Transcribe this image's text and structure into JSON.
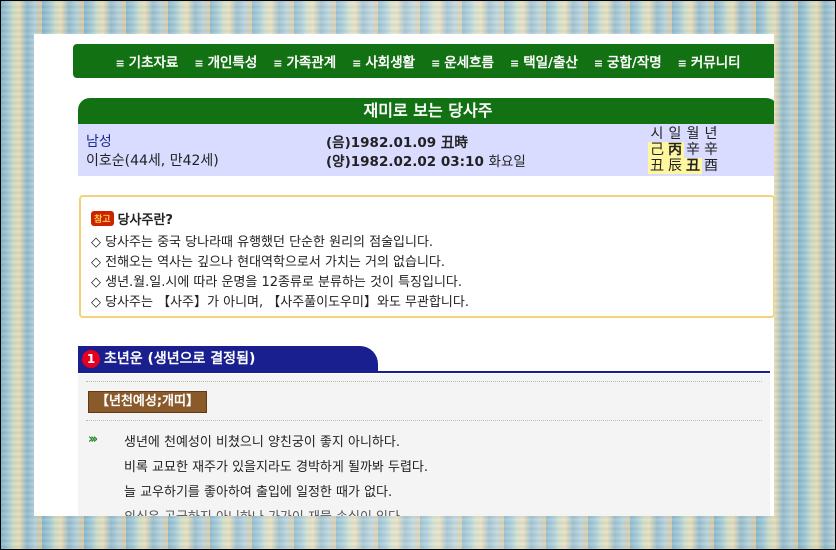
{
  "menu": [
    "기초자료",
    "개인특성",
    "가족관계",
    "사회생활",
    "운세흐름",
    "택일/출산",
    "궁합/작명",
    "커뮤니티"
  ],
  "menu_bullet": "≡",
  "title": "재미로 보는 당사주",
  "profile": {
    "gender": "남성",
    "name_age": "이호순(44세, 만42세)",
    "lunar": "(음)1982.01.09 丑時",
    "solar_date": "(양)1982.02.02 03:10",
    "solar_day": "화요일"
  },
  "pillars": {
    "headers": [
      "시",
      "일",
      "월",
      "년"
    ],
    "stems": [
      "己",
      "丙",
      "辛",
      "辛"
    ],
    "branches": [
      "丑",
      "辰",
      "丑",
      "酉"
    ]
  },
  "notice": {
    "badge": "참고",
    "title": "당사주란?",
    "lines": [
      "◇ 당사주는 중국 당나라때 유행했던 단순한 원리의 점술입니다.",
      "◇ 전해오는 역사는 깊으나 현대역학으로서 가치는 거의 없습니다.",
      "◇ 생년.월.일.시에 따라 운명을 12종류로 분류하는 것이 특징입니다.",
      "◇ 당사주는 【사주】가 아니며, 【사주풀이도우미】와도 무관합니다."
    ]
  },
  "section": {
    "number": "1",
    "title": "초년운 (생년으로 결정됨)",
    "subtitle": "【년천예성;개띠】",
    "paragraphs": [
      "생년에 천예성이 비쳤으니 양친궁이 좋지 아니하다.",
      "비록 교묘한 재주가 있을지라도 경박하게 될까봐 두렵다.",
      "늘 교우하기를 좋아하여 출입에 일정한 때가 없다.",
      "의식은 곤궁하지 아니하나 가가이 재물 손실이 있다."
    ]
  },
  "colors": {
    "menu_green": "#127112",
    "section_blue": "#1a1f8f",
    "info_bg": "#d9dcff",
    "notice_border": "#f3d27a",
    "subtag_brown": "#8b5a2b"
  }
}
